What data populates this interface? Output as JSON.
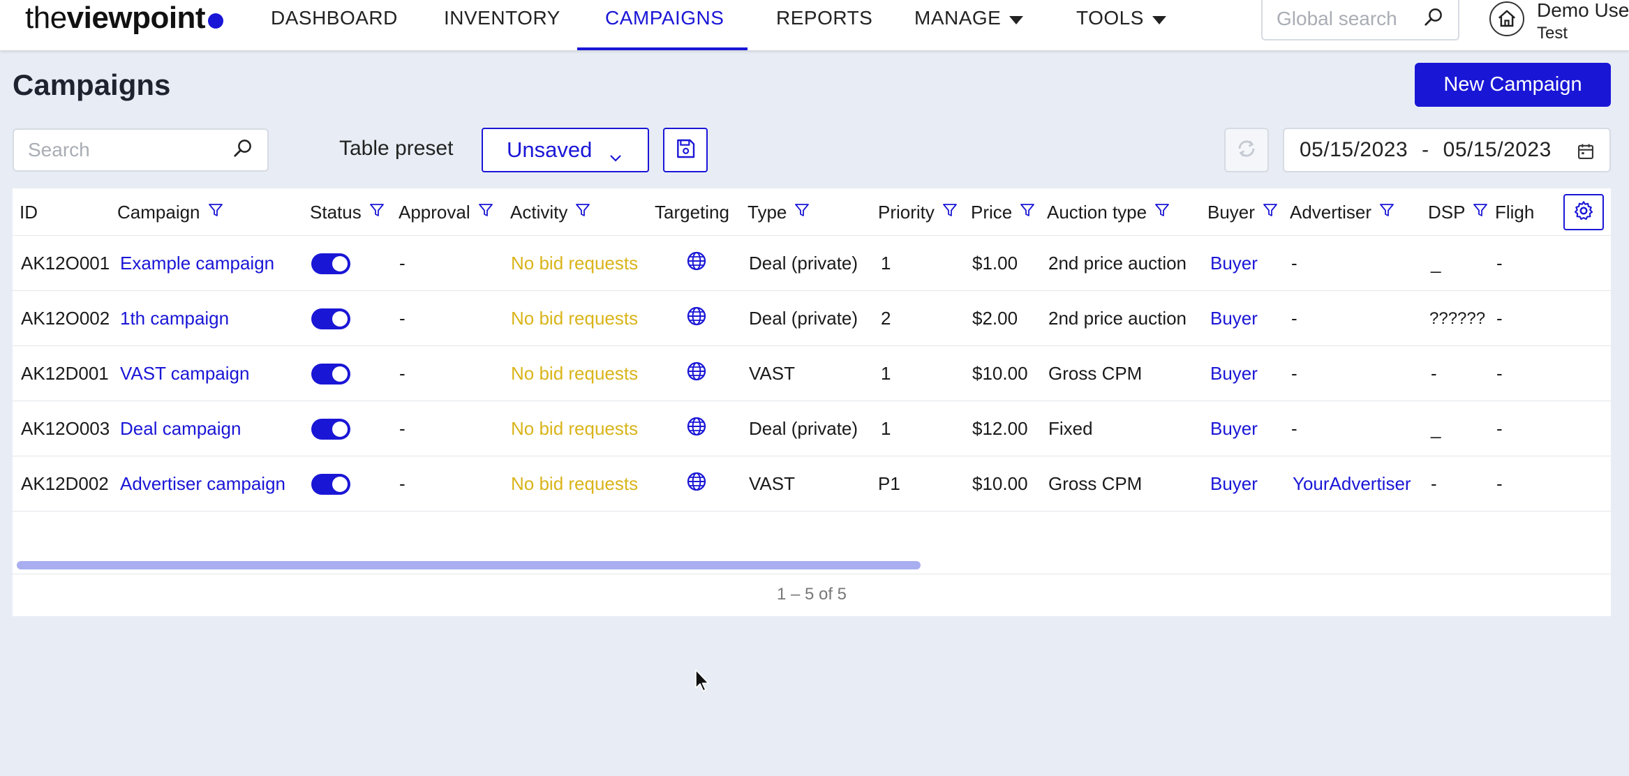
{
  "logo": {
    "thin": "the",
    "bold": "viewpoint"
  },
  "nav": {
    "items": [
      {
        "label": "DASHBOARD"
      },
      {
        "label": "INVENTORY"
      },
      {
        "label": "CAMPAIGNS"
      },
      {
        "label": "REPORTS"
      },
      {
        "label": "MANAGE"
      },
      {
        "label": "TOOLS"
      }
    ],
    "active": "CAMPAIGNS"
  },
  "global_search": {
    "placeholder": "Global search"
  },
  "user": {
    "name": "Demo Use",
    "org": "Test"
  },
  "page": {
    "title": "Campaigns",
    "new_button": "New Campaign"
  },
  "toolbar": {
    "search_placeholder": "Search",
    "preset_label": "Table preset",
    "preset_value": "Unsaved",
    "date_from": "05/15/2023",
    "date_sep": "-",
    "date_to": "05/15/2023"
  },
  "table": {
    "columns": [
      "ID",
      "Campaign",
      "Status",
      "Approval",
      "Activity",
      "Targeting",
      "Type",
      "Priority",
      "Price",
      "Auction type",
      "Buyer",
      "Advertiser",
      "DSP",
      "Fligh"
    ],
    "rows": [
      {
        "id": "AK12O001",
        "campaign": "Example campaign",
        "status": "on",
        "approval": "-",
        "activity": "No bid requests",
        "type": "Deal (private)",
        "priority": "1",
        "price": "$1.00",
        "auction": "2nd price auction",
        "buyer": "Buyer",
        "advertiser": "-",
        "dsp": "_",
        "flight": "-"
      },
      {
        "id": "AK12O002",
        "campaign": "1th campaign",
        "status": "on",
        "approval": "-",
        "activity": "No bid requests",
        "type": "Deal (private)",
        "priority": "2",
        "price": "$2.00",
        "auction": "2nd price auction",
        "buyer": "Buyer",
        "advertiser": "-",
        "dsp": "??????",
        "flight": "-"
      },
      {
        "id": "AK12D001",
        "campaign": "VAST campaign",
        "status": "on",
        "approval": "-",
        "activity": "No bid requests",
        "type": "VAST",
        "priority": "1",
        "price": "$10.00",
        "auction": "Gross CPM",
        "buyer": "Buyer",
        "advertiser": "-",
        "dsp": "-",
        "flight": "-"
      },
      {
        "id": "AK12O003",
        "campaign": "Deal campaign",
        "status": "on",
        "approval": "-",
        "activity": "No bid requests",
        "type": "Deal (private)",
        "priority": "1",
        "price": "$12.00",
        "auction": "Fixed",
        "buyer": "Buyer",
        "advertiser": "-",
        "dsp": "_",
        "flight": "-"
      },
      {
        "id": "AK12D002",
        "campaign": "Advertiser campaign",
        "status": "on",
        "approval": "-",
        "activity": "No bid requests",
        "type": "VAST",
        "priority": "P1",
        "price": "$10.00",
        "auction": "Gross CPM",
        "buyer": "Buyer",
        "advertiser": "YourAdvertiser",
        "dsp": "-",
        "flight": "-"
      }
    ],
    "paginator": "1 – 5 of 5"
  },
  "colors": {
    "accent": "#1a16d6",
    "warning": "#d9b41a",
    "background": "#e8edf5"
  }
}
